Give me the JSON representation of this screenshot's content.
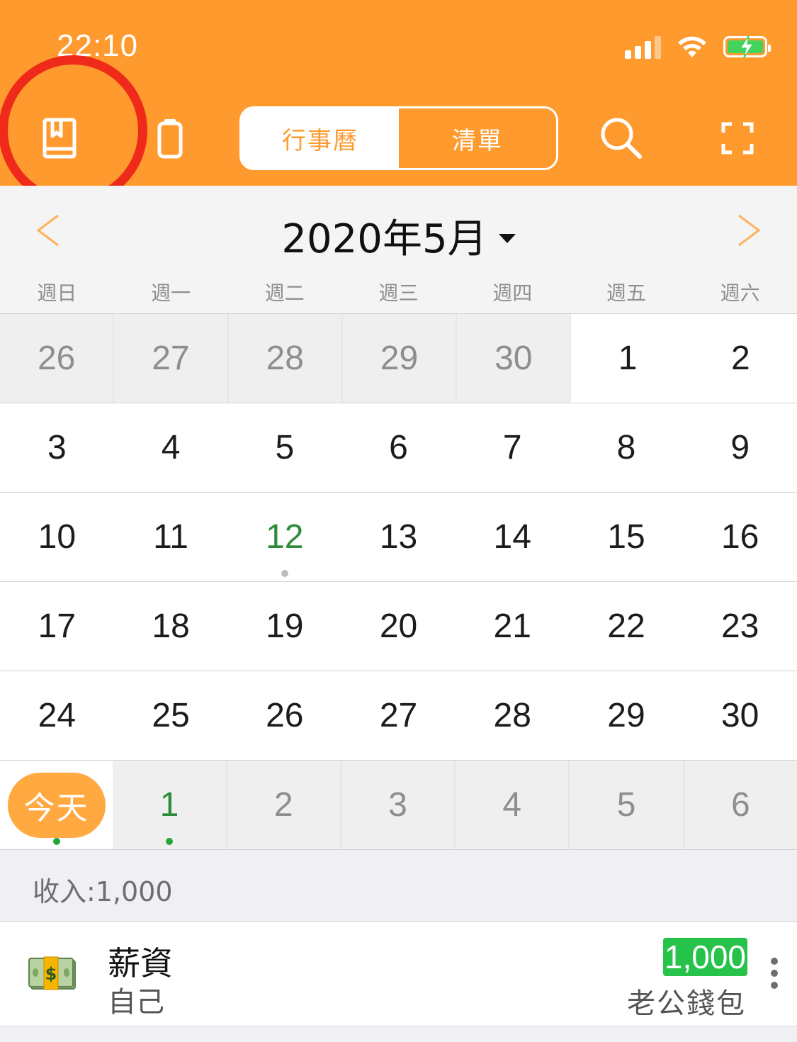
{
  "status_bar": {
    "time": "22:10"
  },
  "toolbar": {
    "segments": [
      {
        "label": "行事曆",
        "active": true
      },
      {
        "label": "清單",
        "active": false
      }
    ]
  },
  "colors": {
    "accent": "#ff9a2e",
    "highlight_ring": "#f02a1a",
    "green_text": "#2e8b3a",
    "amount_bg": "#26c24a"
  },
  "icons": {
    "book": "book-icon",
    "wallet": "wallet-icon",
    "search": "search-icon",
    "fullscreen": "fullscreen-icon",
    "prev": "chevron-left-icon",
    "next": "chevron-right-icon",
    "money": "money-bill-icon",
    "more": "more-vertical-icon"
  },
  "calendar": {
    "month_title": "2020年5月",
    "weekdays": [
      "週日",
      "週一",
      "週二",
      "週三",
      "週四",
      "週五",
      "週六"
    ],
    "weeks": [
      [
        {
          "d": "26",
          "other": true
        },
        {
          "d": "27",
          "other": true
        },
        {
          "d": "28",
          "other": true
        },
        {
          "d": "29",
          "other": true
        },
        {
          "d": "30",
          "other": true
        },
        {
          "d": "1"
        },
        {
          "d": "2"
        }
      ],
      [
        {
          "d": "3"
        },
        {
          "d": "4"
        },
        {
          "d": "5"
        },
        {
          "d": "6"
        },
        {
          "d": "7"
        },
        {
          "d": "8"
        },
        {
          "d": "9"
        }
      ],
      [
        {
          "d": "10"
        },
        {
          "d": "11"
        },
        {
          "d": "12",
          "green": true,
          "dot": "gray"
        },
        {
          "d": "13"
        },
        {
          "d": "14"
        },
        {
          "d": "15"
        },
        {
          "d": "16"
        }
      ],
      [
        {
          "d": "17"
        },
        {
          "d": "18"
        },
        {
          "d": "19"
        },
        {
          "d": "20"
        },
        {
          "d": "21"
        },
        {
          "d": "22"
        },
        {
          "d": "23"
        }
      ],
      [
        {
          "d": "24"
        },
        {
          "d": "25"
        },
        {
          "d": "26"
        },
        {
          "d": "27"
        },
        {
          "d": "28"
        },
        {
          "d": "29"
        },
        {
          "d": "30"
        }
      ],
      [
        {
          "d": "今天",
          "today": true,
          "dot": "green"
        },
        {
          "d": "1",
          "other": true,
          "green": true,
          "dot": "green"
        },
        {
          "d": "2",
          "other": true
        },
        {
          "d": "3",
          "other": true
        },
        {
          "d": "4",
          "other": true
        },
        {
          "d": "5",
          "other": true
        },
        {
          "d": "6",
          "other": true
        }
      ]
    ]
  },
  "summary": {
    "text": "收入:1,000"
  },
  "entry": {
    "title": "薪資",
    "subtitle": "自己",
    "amount": "1,000",
    "account": "老公錢包"
  }
}
